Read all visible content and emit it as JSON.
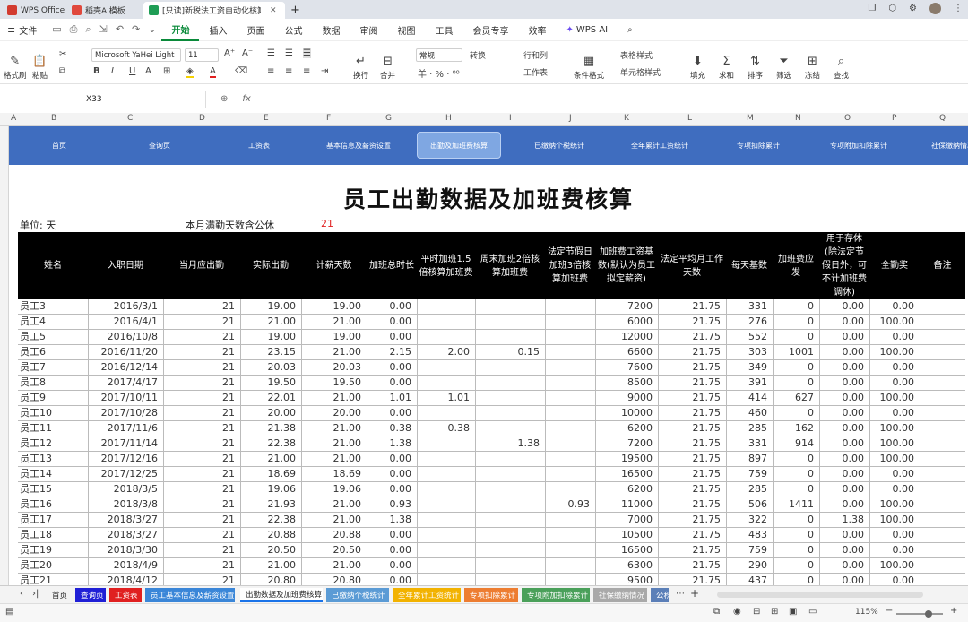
{
  "window": {
    "tabs": [
      {
        "label": "WPS Office",
        "color": "#d23b2f"
      },
      {
        "label": "稻壳AI模板",
        "color": "#e0483c"
      },
      {
        "label": "[只读]新税法工资自动化核算",
        "color": "#1f9d55"
      }
    ],
    "new_tab": "+"
  },
  "menu": {
    "file": "文件",
    "items": [
      "开始",
      "插入",
      "页面",
      "公式",
      "数据",
      "审阅",
      "视图",
      "工具",
      "会员专享",
      "效率"
    ],
    "active": "开始",
    "ai": "WPS AI"
  },
  "ribbon": {
    "format_painter": "格式刷",
    "paste": "粘贴",
    "font_name": "Microsoft YaHei Light",
    "font_size": "11",
    "wrap": "换行",
    "merge": "合并",
    "number_format": "常规",
    "convert": "转换",
    "row_col": "行和列",
    "worksheet": "工作表",
    "cond_format": "条件格式",
    "table_style": "表格样式",
    "cell_style": "单元格样式",
    "fill": "填充",
    "sum": "求和",
    "sort": "排序",
    "filter": "筛选",
    "freeze": "冻结",
    "find": "查找"
  },
  "formula_bar": {
    "cell_ref": "X33",
    "fx": "fx"
  },
  "columns": [
    "A",
    "B",
    "C",
    "D",
    "E",
    "F",
    "G",
    "H",
    "I",
    "J",
    "K",
    "L",
    "M",
    "N",
    "O",
    "P",
    "Q"
  ],
  "nav": {
    "items": [
      "首页",
      "查询页",
      "工资表",
      "基本信息及薪资设置",
      "出勤及加班费核算",
      "已缴纳个税统计",
      "全年累计工资统计",
      "专项扣除累计",
      "专项附加扣除累计",
      "社保缴纳情况"
    ],
    "active": "出勤及加班费核算"
  },
  "sheet": {
    "title": "员工出勤数据及加班费核算",
    "unit_label": "单位: 天",
    "workdays_label": "本月满勤天数含公休",
    "workdays_value": "21"
  },
  "table": {
    "headers": [
      "姓名",
      "入职日期",
      "当月应出勤",
      "实际出勤",
      "计薪天数",
      "加班总时长",
      "平时加班1.5倍核算加班费",
      "周末加班2倍核算加班费",
      "法定节假日加班3倍核算加班费",
      "加班费工资基数(默认为员工拟定薪资)",
      "法定平均月工作天数",
      "每天基数",
      "加班费应发",
      "用于存休(除法定节假日外，可不计加班费调休)",
      "全勤奖",
      "备注"
    ],
    "rows": [
      [
        "员工3",
        "2016/3/1",
        "21",
        "19.00",
        "19.00",
        "0.00",
        "",
        "",
        "",
        "7200",
        "21.75",
        "331",
        "0",
        "0.00",
        "0.00",
        ""
      ],
      [
        "员工4",
        "2016/4/1",
        "21",
        "21.00",
        "21.00",
        "0.00",
        "",
        "",
        "",
        "6000",
        "21.75",
        "276",
        "0",
        "0.00",
        "100.00",
        ""
      ],
      [
        "员工5",
        "2016/10/8",
        "21",
        "19.00",
        "19.00",
        "0.00",
        "",
        "",
        "",
        "12000",
        "21.75",
        "552",
        "0",
        "0.00",
        "0.00",
        ""
      ],
      [
        "员工6",
        "2016/11/20",
        "21",
        "23.15",
        "21.00",
        "2.15",
        "2.00",
        "0.15",
        "",
        "6600",
        "21.75",
        "303",
        "1001",
        "0.00",
        "100.00",
        ""
      ],
      [
        "员工7",
        "2016/12/14",
        "21",
        "20.03",
        "20.03",
        "0.00",
        "",
        "",
        "",
        "7600",
        "21.75",
        "349",
        "0",
        "0.00",
        "0.00",
        ""
      ],
      [
        "员工8",
        "2017/4/17",
        "21",
        "19.50",
        "19.50",
        "0.00",
        "",
        "",
        "",
        "8500",
        "21.75",
        "391",
        "0",
        "0.00",
        "0.00",
        ""
      ],
      [
        "员工9",
        "2017/10/11",
        "21",
        "22.01",
        "21.00",
        "1.01",
        "1.01",
        "",
        "",
        "9000",
        "21.75",
        "414",
        "627",
        "0.00",
        "100.00",
        ""
      ],
      [
        "员工10",
        "2017/10/28",
        "21",
        "20.00",
        "20.00",
        "0.00",
        "",
        "",
        "",
        "10000",
        "21.75",
        "460",
        "0",
        "0.00",
        "0.00",
        ""
      ],
      [
        "员工11",
        "2017/11/6",
        "21",
        "21.38",
        "21.00",
        "0.38",
        "0.38",
        "",
        "",
        "6200",
        "21.75",
        "285",
        "162",
        "0.00",
        "100.00",
        ""
      ],
      [
        "员工12",
        "2017/11/14",
        "21",
        "22.38",
        "21.00",
        "1.38",
        "",
        "1.38",
        "",
        "7200",
        "21.75",
        "331",
        "914",
        "0.00",
        "100.00",
        ""
      ],
      [
        "员工13",
        "2017/12/16",
        "21",
        "21.00",
        "21.00",
        "0.00",
        "",
        "",
        "",
        "19500",
        "21.75",
        "897",
        "0",
        "0.00",
        "100.00",
        ""
      ],
      [
        "员工14",
        "2017/12/25",
        "21",
        "18.69",
        "18.69",
        "0.00",
        "",
        "",
        "",
        "16500",
        "21.75",
        "759",
        "0",
        "0.00",
        "0.00",
        ""
      ],
      [
        "员工15",
        "2018/3/5",
        "21",
        "19.06",
        "19.06",
        "0.00",
        "",
        "",
        "",
        "6200",
        "21.75",
        "285",
        "0",
        "0.00",
        "0.00",
        ""
      ],
      [
        "员工16",
        "2018/3/8",
        "21",
        "21.93",
        "21.00",
        "0.93",
        "",
        "",
        "0.93",
        "11000",
        "21.75",
        "506",
        "1411",
        "0.00",
        "100.00",
        ""
      ],
      [
        "员工17",
        "2018/3/27",
        "21",
        "22.38",
        "21.00",
        "1.38",
        "",
        "",
        "",
        "7000",
        "21.75",
        "322",
        "0",
        "1.38",
        "100.00",
        ""
      ],
      [
        "员工18",
        "2018/3/27",
        "21",
        "20.88",
        "20.88",
        "0.00",
        "",
        "",
        "",
        "10500",
        "21.75",
        "483",
        "0",
        "0.00",
        "0.00",
        ""
      ],
      [
        "员工19",
        "2018/3/30",
        "21",
        "20.50",
        "20.50",
        "0.00",
        "",
        "",
        "",
        "16500",
        "21.75",
        "759",
        "0",
        "0.00",
        "0.00",
        ""
      ],
      [
        "员工20",
        "2018/4/9",
        "21",
        "21.00",
        "21.00",
        "0.00",
        "",
        "",
        "",
        "6300",
        "21.75",
        "290",
        "0",
        "0.00",
        "100.00",
        ""
      ],
      [
        "员工21",
        "2018/4/12",
        "21",
        "20.80",
        "20.80",
        "0.00",
        "",
        "",
        "",
        "9500",
        "21.75",
        "437",
        "0",
        "0.00",
        "0.00",
        ""
      ]
    ]
  },
  "sheet_tabs": [
    {
      "label": "首页",
      "color": "#f3f3f3",
      "text": "#222"
    },
    {
      "label": "查询页",
      "color": "#1f1fd6",
      "text": "#fff"
    },
    {
      "label": "工资表",
      "color": "#e02020",
      "text": "#fff"
    },
    {
      "label": "员工基本信息及薪资设置",
      "color": "#3a86d8",
      "text": "#fff"
    },
    {
      "label": "出勤数据及加班费核算",
      "color": "#ffffff",
      "text": "#222"
    },
    {
      "label": "已缴纳个税统计",
      "color": "#5b9bd5",
      "text": "#fff"
    },
    {
      "label": "全年累计工资统计",
      "color": "#f2b200",
      "text": "#fff"
    },
    {
      "label": "专项扣除累计",
      "color": "#ed7d31",
      "text": "#fff"
    },
    {
      "label": "专项附加扣除累计",
      "color": "#4aa05a",
      "text": "#fff"
    },
    {
      "label": "社保缴纳情况",
      "color": "#a9a9a9",
      "text": "#fff"
    },
    {
      "label": "公积",
      "color": "#5b7fb8",
      "text": "#fff"
    }
  ],
  "status": {
    "zoom": "115%"
  }
}
